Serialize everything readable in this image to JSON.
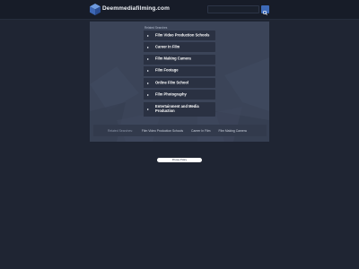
{
  "header": {
    "site_name": "Deemmediafilming.com",
    "logo_icon": "cube-logo-icon",
    "search": {
      "placeholder": "",
      "button_icon": "search-icon"
    }
  },
  "related": {
    "heading": "Related Searches",
    "items": [
      {
        "label": "Film Video Production Schools"
      },
      {
        "label": "Career In Film"
      },
      {
        "label": "Film Making Camera"
      },
      {
        "label": "Film Footage"
      },
      {
        "label": "Online Film School"
      },
      {
        "label": "Film Photography"
      },
      {
        "label": "Entertainment and Media Production"
      }
    ]
  },
  "related_bar": {
    "label": "Related Searches:",
    "links": [
      {
        "label": "Film Video Production Schools"
      },
      {
        "label": "Career In Film"
      },
      {
        "label": "Film Making Camera"
      }
    ]
  },
  "footer": {
    "privacy_label": "Privacy Policy"
  },
  "colors": {
    "background": "#1f2533",
    "topbar": "#171c28",
    "panel": "#3b4458",
    "link_item": "#2a3142",
    "accent": "#3d6ab8"
  }
}
